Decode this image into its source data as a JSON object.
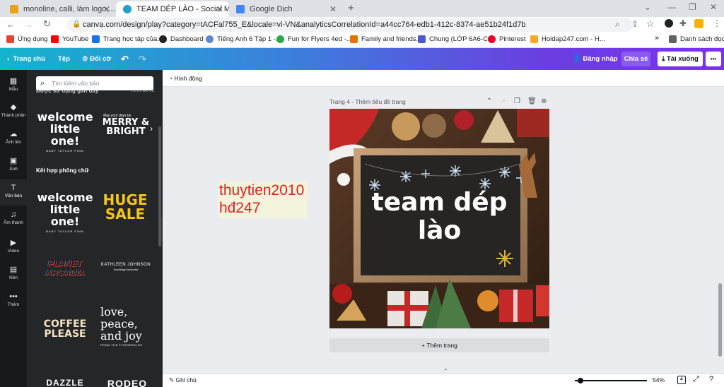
{
  "browser": {
    "tabs": [
      {
        "title": "monoline, calli, làm logo,.....: tea",
        "active": false
      },
      {
        "title": "TEAM DÉP LÀO - Social Media",
        "active": true
      },
      {
        "title": "Google Dịch",
        "active": false
      }
    ],
    "new_tab": "+",
    "url": "canva.com/design/play?category=tACFal755_E&locale=vi-VN&analyticsCorrelationId=a44cc764-edb1-412c-8374-ae51b24f1d7b",
    "bookmarks": [
      "Ứng dụng",
      "YouTube",
      "Trang học tập của...",
      "Dashboard",
      "Tiếng Anh 6 Tập 1 -...",
      "Fun for Flyers 4ed -...",
      "Family and friends...",
      "Chung (LỚP 6A6-C...",
      "Pinterest",
      "Hoidap247.com - H..."
    ],
    "bookmarks_more": "»",
    "reading_list": "Danh sách đọc"
  },
  "canva_header": {
    "home": "Trang chủ",
    "file": "Tệp",
    "resize": "Đổi cỡ",
    "login": "Đăng nhập",
    "share": "Chia sẻ",
    "download": "Tải xuống",
    "more": "•••"
  },
  "rail": [
    {
      "icon": "template-icon",
      "glyph": "▦",
      "label": "Mẫu"
    },
    {
      "icon": "elements-icon",
      "glyph": "◆",
      "label": "Thành phần"
    },
    {
      "icon": "upload-icon",
      "glyph": "☁",
      "label": "Ảnh lên"
    },
    {
      "icon": "photo-icon",
      "glyph": "▣",
      "label": "Ảnh"
    },
    {
      "icon": "text-icon",
      "glyph": "T",
      "label": "Văn bản"
    },
    {
      "icon": "music-icon",
      "glyph": "♫",
      "label": "Âm thanh"
    },
    {
      "icon": "video-icon",
      "glyph": "▶",
      "label": "Video"
    },
    {
      "icon": "background-icon",
      "glyph": "▤",
      "label": "Nền"
    },
    {
      "icon": "more-icon",
      "glyph": "•••",
      "label": "Thêm"
    }
  ],
  "panel": {
    "search_placeholder": "Tìm kiếm văn bản",
    "recent_label": "Được sử dụng gần đây",
    "see_all": "Xem tất cả",
    "combos_label": "Kết hợp phông chữ",
    "recent_tiles": [
      {
        "main": "welcome little one!",
        "sub": "BABY TAYLOR FINN"
      },
      {
        "pre": "May your days be",
        "main": "MERRY & BRIGHT"
      }
    ],
    "combo_tiles": [
      {
        "main": "welcome little one!",
        "sub": "BABY TAYLOR FINN"
      },
      {
        "main": "HUGE SALE"
      },
      {
        "main": "PLANET ARCADIA"
      },
      {
        "main": "KATHLEEN JOHNSON",
        "sub": "Sociology Instructor"
      },
      {
        "main": "COFFEE PLEASE"
      },
      {
        "main": "love, peace, and joy",
        "sub": "FROM THE FITZGERALDS"
      },
      {
        "main": "DAZZLE"
      },
      {
        "main": "RODEO"
      }
    ]
  },
  "workspace": {
    "animate": "Hình động",
    "page_title": "Trang 4 - Thêm tiêu đề trang",
    "loose_text": [
      "thuytien2010",
      "hđ247"
    ],
    "design_text": [
      "team dép",
      "lào"
    ],
    "add_page": "+ Thêm trang",
    "notes": "Ghi chú",
    "zoom": "54%",
    "page_count": "4"
  }
}
